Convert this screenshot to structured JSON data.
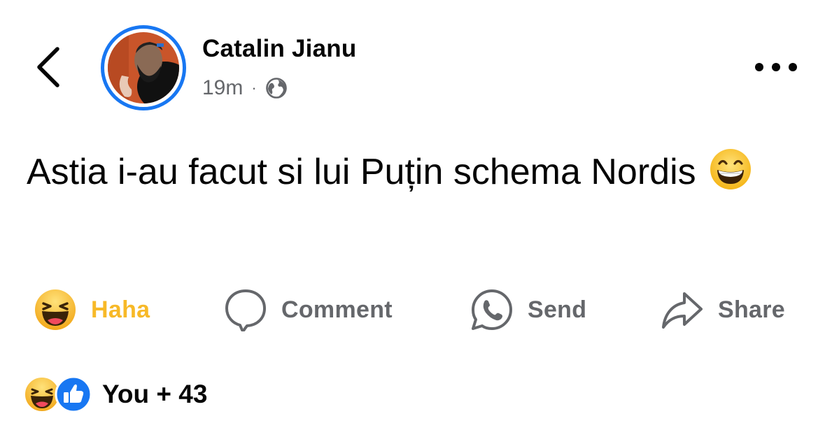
{
  "post": {
    "author": "Catalin Jianu",
    "time": "19m",
    "separator": "·",
    "privacy_icon": "globe-icon",
    "text": "Astia i-au facut si lui Puțin schema Nordis",
    "text_emoji": "grinning-face-emoji"
  },
  "header": {
    "back_icon": "chevron-left-icon",
    "more_icon": "more-horizontal-icon"
  },
  "actions": {
    "haha": "Haha",
    "comment": "Comment",
    "send": "Send",
    "share": "Share"
  },
  "reactions": {
    "summary": "You + 43",
    "icons": [
      "haha-reaction-icon",
      "like-reaction-icon"
    ]
  },
  "colors": {
    "accent": "#1877f2",
    "haha": "#f7b928",
    "muted": "#65676b",
    "text": "#050505"
  }
}
